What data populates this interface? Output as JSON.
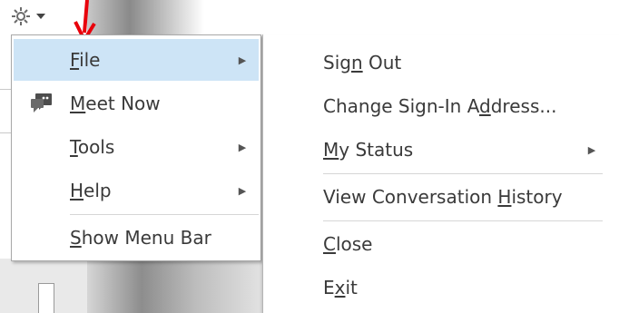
{
  "toolbar": {
    "gear_icon": "gear-icon",
    "dropdown_icon": "caret-down-icon",
    "annotation_arrow_color": "#e8000b"
  },
  "menu": {
    "items": [
      {
        "label_pre": "",
        "label_key": "F",
        "label_post": "ile",
        "has_submenu": true,
        "selected": true
      },
      {
        "label_pre": "",
        "label_key": "M",
        "label_post": "eet Now",
        "icon": "meet-now-icon",
        "has_submenu": false
      },
      {
        "label_pre": "",
        "label_key": "T",
        "label_post": "ools",
        "has_submenu": true
      },
      {
        "label_pre": "",
        "label_key": "H",
        "label_post": "elp",
        "has_submenu": true
      },
      {
        "label_pre": "",
        "label_key": "S",
        "label_post": "how Menu Bar",
        "has_submenu": false
      }
    ],
    "selected_bg": "#cde4f6"
  },
  "submenu": {
    "items": [
      {
        "label_pre": "Sig",
        "label_key": "n",
        "label_post": " Out"
      },
      {
        "label_pre": "Change Sign-In A",
        "label_key": "d",
        "label_post": "dress..."
      },
      {
        "label_pre": "",
        "label_key": "M",
        "label_post": "y Status",
        "has_submenu": true
      },
      {
        "label_pre": "View Conversation ",
        "label_key": "H",
        "label_post": "istory"
      },
      {
        "label_pre": "",
        "label_key": "C",
        "label_post": "lose"
      },
      {
        "label_pre": "E",
        "label_key": "x",
        "label_post": "it"
      }
    ]
  }
}
